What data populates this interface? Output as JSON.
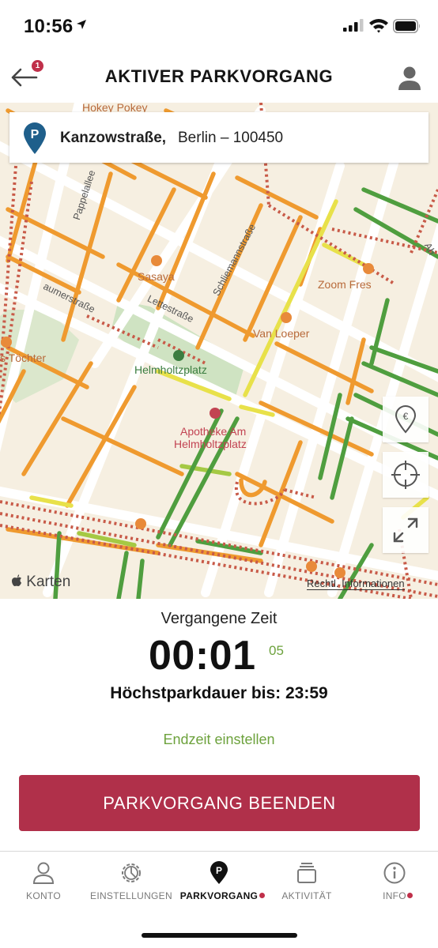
{
  "status_bar": {
    "time": "10:56"
  },
  "header": {
    "title": "AKTIVER PARKVORGANG",
    "back_badge": "1"
  },
  "address": {
    "street": "Kanzowstraße,",
    "rest": "Berlin – 100450"
  },
  "map": {
    "labels": {
      "pappelallee": "Pappelallee",
      "schliemannstrasse": "Schliemannstraße",
      "lettestrasse": "Lettestraße",
      "raumerstrasse": "aumerstraße",
      "sasaya": "Sasaya",
      "zoom": "Zoom Fres",
      "van_loeper": "Van Loeper",
      "toechter": "s Töchter",
      "helmholtzplatz": "Helmholtzplatz",
      "apotheke_1": "Apotheke Am",
      "apotheke_2": "Helmholtzplatz",
      "hokey": "Hokey Pokey",
      "ah": "Ah"
    },
    "attribution": "Karten",
    "legal": "Rechtl. Informationen"
  },
  "timer": {
    "label": "Vergangene Zeit",
    "value": "00:01",
    "seconds": "05",
    "max_duration": "Höchstparkdauer bis: 23:59"
  },
  "actions": {
    "set_end_time": "Endzeit einstellen",
    "end_parking": "PARKVORGANG BEENDEN"
  },
  "tabs": [
    {
      "label": "KONTO",
      "icon": "person-icon"
    },
    {
      "label": "EINSTELLUNGEN",
      "icon": "gear-icon"
    },
    {
      "label": "PARKVORGANG",
      "icon": "parking-pin-icon",
      "active": true,
      "dot": true
    },
    {
      "label": "AKTIVITÄT",
      "icon": "stack-icon"
    },
    {
      "label": "INFO",
      "icon": "info-icon",
      "dot": true
    }
  ],
  "colors": {
    "accent_red": "#b0304a",
    "accent_green": "#6da23d",
    "road_orange": "#ef9a2f",
    "road_yellow": "#e8e14a",
    "road_green": "#4f9e3f",
    "road_restricted": "#c85a48",
    "map_base": "#f6efe1",
    "park": "#cfe3c2"
  }
}
